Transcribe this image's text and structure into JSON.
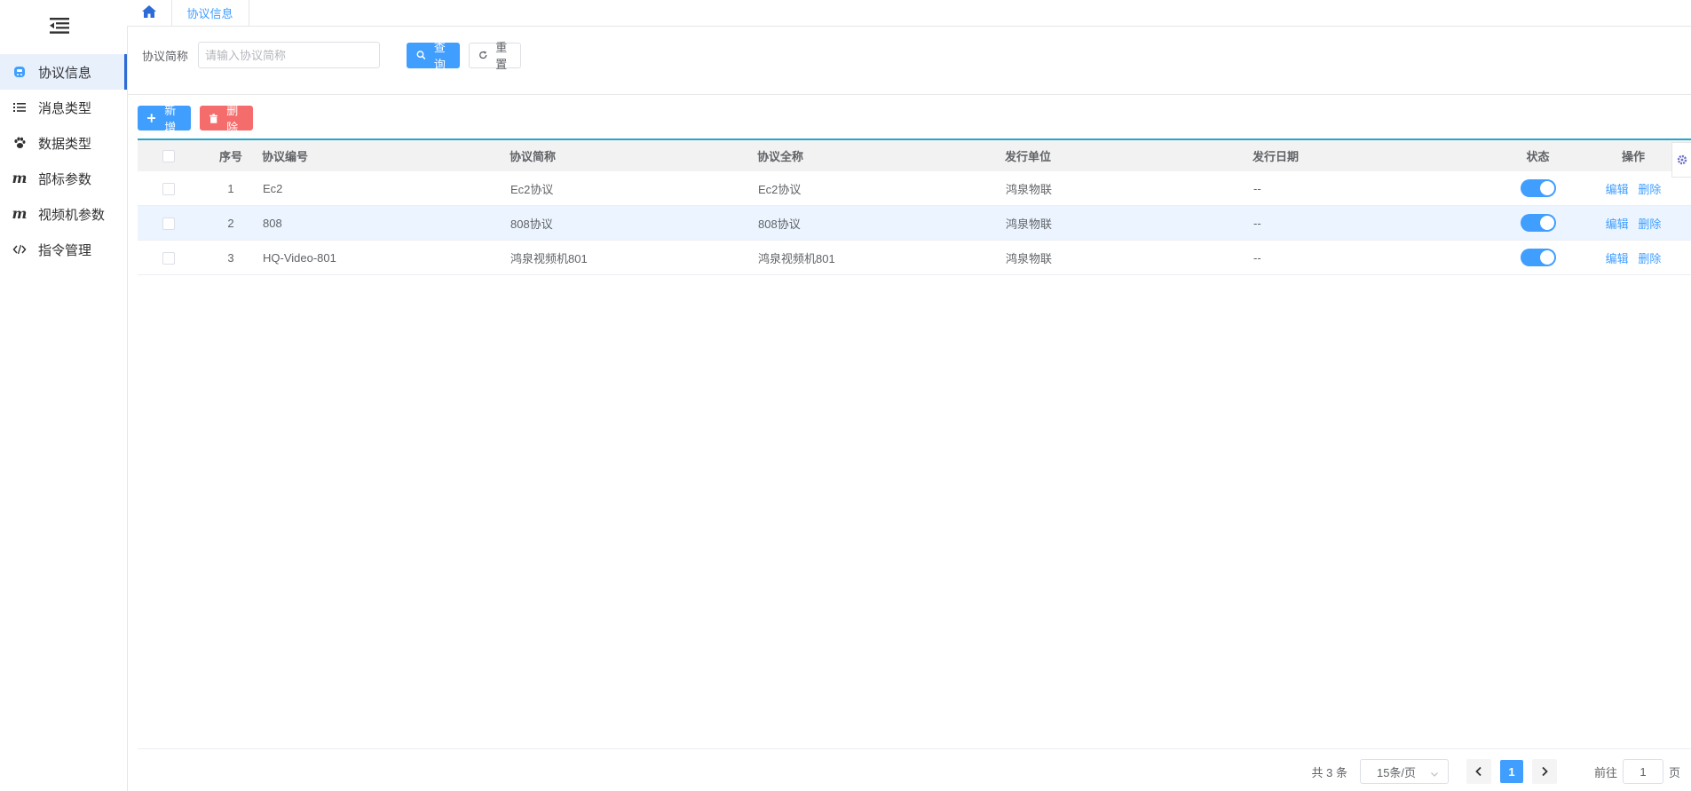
{
  "sidebar": {
    "items": [
      {
        "label": "协议信息",
        "icon": "protocol-icon",
        "active": true
      },
      {
        "label": "消息类型",
        "icon": "list-icon"
      },
      {
        "label": "数据类型",
        "icon": "paw-icon"
      },
      {
        "label": "部标参数",
        "icon": "m-icon"
      },
      {
        "label": "视频机参数",
        "icon": "m-icon"
      },
      {
        "label": "指令管理",
        "icon": "code-icon"
      }
    ]
  },
  "tabs": {
    "home_icon": "home-icon",
    "active_tab": "协议信息"
  },
  "search": {
    "label": "协议简称",
    "placeholder": "请输入协议简称",
    "value": "",
    "query_label": "查询",
    "reset_label": "重置"
  },
  "toolbar": {
    "add_label": "新增",
    "delete_label": "删除"
  },
  "table": {
    "headers": [
      "序号",
      "协议编号",
      "协议简称",
      "协议全称",
      "发行单位",
      "发行日期",
      "状态",
      "操作"
    ],
    "rows": [
      {
        "index": "1",
        "code": "Ec2",
        "short": "Ec2协议",
        "full": "Ec2协议",
        "issuer": "鸿泉物联",
        "date": "--",
        "status": true,
        "edit": "编辑",
        "delete": "删除"
      },
      {
        "index": "2",
        "code": "808",
        "short": "808协议",
        "full": "808协议",
        "issuer": "鸿泉物联",
        "date": "--",
        "status": true,
        "edit": "编辑",
        "delete": "删除"
      },
      {
        "index": "3",
        "code": "HQ-Video-801",
        "short": "鸿泉视频机801",
        "full": "鸿泉视频机801",
        "issuer": "鸿泉物联",
        "date": "--",
        "status": true,
        "edit": "编辑",
        "delete": "删除"
      }
    ]
  },
  "pagination": {
    "total": "共 3 条",
    "page_size": "15条/页",
    "current": "1",
    "goto_label": "前往",
    "goto_value": "1",
    "page_suffix": "页"
  },
  "colors": {
    "primary": "#409eff",
    "danger": "#f56c6c",
    "table_accent": "#26a6c9"
  }
}
